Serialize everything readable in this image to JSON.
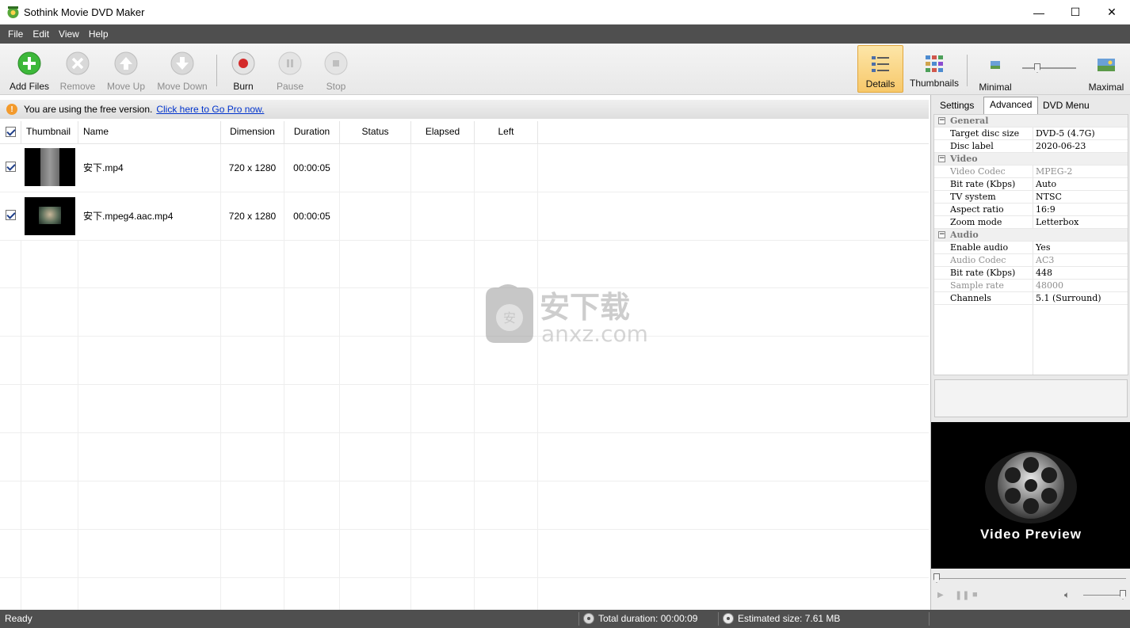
{
  "window": {
    "title": "Sothink Movie DVD Maker",
    "min_glyph": "—",
    "max_glyph": "☐",
    "close_glyph": "✕"
  },
  "menu": [
    "File",
    "Edit",
    "View",
    "Help"
  ],
  "toolbar": {
    "add_files": "Add Files",
    "remove": "Remove",
    "move_up": "Move Up",
    "move_down": "Move Down",
    "burn": "Burn",
    "pause": "Pause",
    "stop": "Stop",
    "details": "Details",
    "thumbnails": "Thumbnails",
    "minimal": "Minimal",
    "maximal": "Maximal",
    "thumb_size_level": 0.25
  },
  "infobar": {
    "icon": "!",
    "text": "You are using the free version.",
    "link": "Click here to Go Pro now."
  },
  "list": {
    "columns": [
      "Thumbnail",
      "Name",
      "Dimension",
      "Duration",
      "Status",
      "Elapsed",
      "Left"
    ],
    "rows": [
      {
        "checked": true,
        "name": "安下.mp4",
        "dimension": "720 x 1280",
        "duration": "00:00:05",
        "status": "",
        "elapsed": "",
        "left": ""
      },
      {
        "checked": true,
        "name": "安下.mpeg4.aac.mp4",
        "dimension": "720 x 1280",
        "duration": "00:00:05",
        "status": "",
        "elapsed": "",
        "left": ""
      }
    ]
  },
  "watermark": {
    "cn": "安下载",
    "en": "anxz.com",
    "badge": "安"
  },
  "panel": {
    "tabs": [
      "Settings",
      "Advanced",
      "DVD Menu"
    ],
    "active_tab": "Advanced",
    "groups": [
      {
        "name": "General",
        "props": [
          {
            "name": "Target disc size",
            "value": "DVD-5 (4.7G)",
            "dim": false
          },
          {
            "name": "Disc label",
            "value": "2020-06-23",
            "dim": false
          }
        ]
      },
      {
        "name": "Video",
        "props": [
          {
            "name": "Video Codec",
            "value": "MPEG-2",
            "dim": true
          },
          {
            "name": "Bit rate (Kbps)",
            "value": "Auto",
            "dim": false
          },
          {
            "name": "TV system",
            "value": "NTSC",
            "dim": false
          },
          {
            "name": "Aspect ratio",
            "value": "16:9",
            "dim": false
          },
          {
            "name": "Zoom mode",
            "value": "Letterbox",
            "dim": false
          }
        ]
      },
      {
        "name": "Audio",
        "props": [
          {
            "name": "Enable audio",
            "value": "Yes",
            "dim": false
          },
          {
            "name": "Audio Codec",
            "value": "AC3",
            "dim": true
          },
          {
            "name": "Bit rate (Kbps)",
            "value": "448",
            "dim": false
          },
          {
            "name": "Sample rate",
            "value": "48000",
            "dim": true
          },
          {
            "name": "Channels",
            "value": "5.1 (Surround)",
            "dim": false
          }
        ]
      }
    ],
    "preview_text": "Video Preview"
  },
  "status": {
    "ready": "Ready",
    "total_duration": "Total duration: 00:00:09",
    "estimated_size": "Estimated size: 7.61 MB"
  },
  "colors": {
    "menubar_bg": "#4f4f4f",
    "accent_green": "#3db83a",
    "burn_red": "#d42a2a",
    "link_blue": "#0033cc",
    "active_view_bg": "#f7c86a"
  }
}
